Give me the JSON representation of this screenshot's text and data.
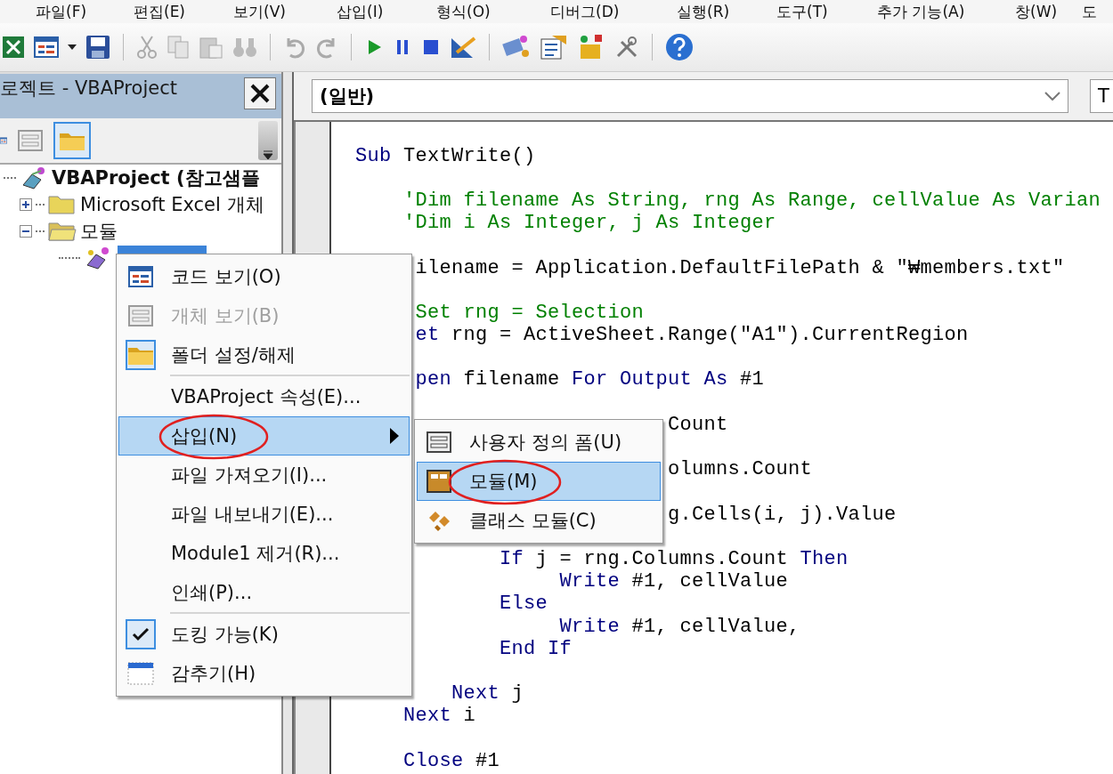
{
  "menu_bar": [
    "파일(F)",
    "편집(E)",
    "보기(V)",
    "삽입(I)",
    "형식(O)",
    "디버그(D)",
    "실행(R)",
    "도구(T)",
    "추가 기능(A)",
    "창(W)",
    "도"
  ],
  "project_panel": {
    "title": "로젝트 - VBAProject",
    "folders_on": true,
    "tree": [
      {
        "label": "VBAProject (참고샘플",
        "selected": false,
        "children": [
          {
            "label": "Microsoft Excel 개체",
            "expanded": false,
            "selected": false
          },
          {
            "label": "모듈",
            "expanded": true,
            "selected": false,
            "children": [
              {
                "selected": true
              }
            ]
          }
        ]
      }
    ]
  },
  "code_window": {
    "object_box": "(일반)",
    "procedure_box": "T",
    "lines": [
      {
        "kind": "code",
        "segments": [
          {
            "kind": "keyword",
            "text": "Sub"
          },
          {
            "kind": "plain",
            "text": " TextWrite()"
          }
        ]
      },
      {
        "kind": "blank"
      },
      {
        "kind": "code",
        "segments": [
          {
            "kind": "comment",
            "text": "    'Dim filename As String, rng As Range, cellValue As Varian"
          }
        ]
      },
      {
        "kind": "code",
        "segments": [
          {
            "kind": "comment",
            "text": "    'Dim i As Integer, j As Integer"
          }
        ]
      },
      {
        "kind": "blank"
      },
      {
        "kind": "code",
        "segments": [
          {
            "kind": "plain",
            "text": "     ilename = Application.DefaultFilePath & \"₩members.txt\""
          }
        ]
      },
      {
        "kind": "blank"
      },
      {
        "kind": "code",
        "segments": [
          {
            "kind": "comment",
            "text": "     Set rng = Selection"
          }
        ]
      },
      {
        "kind": "code",
        "segments": [
          {
            "kind": "keyword",
            "text": "     et"
          },
          {
            "kind": "plain",
            "text": " rng = ActiveSheet.Range(\"A1\").CurrentRegion"
          }
        ]
      },
      {
        "kind": "blank"
      },
      {
        "kind": "code",
        "segments": [
          {
            "kind": "keyword",
            "text": "     pen"
          },
          {
            "kind": "plain",
            "text": " filename "
          },
          {
            "kind": "keyword",
            "text": "For Output As"
          },
          {
            "kind": "plain",
            "text": " #1"
          }
        ]
      },
      {
        "kind": "blank"
      },
      {
        "kind": "code",
        "segments": [
          {
            "kind": "plain",
            "text": "                          Count"
          }
        ]
      },
      {
        "kind": "blank"
      },
      {
        "kind": "code",
        "segments": [
          {
            "kind": "plain",
            "text": "                          olumns.Count"
          }
        ]
      },
      {
        "kind": "blank"
      },
      {
        "kind": "code",
        "segments": [
          {
            "kind": "plain",
            "text": "                          g.Cells(i, j).Value"
          }
        ]
      },
      {
        "kind": "blank"
      },
      {
        "kind": "code",
        "segments": [
          {
            "kind": "keyword",
            "text": "            If"
          },
          {
            "kind": "plain",
            "text": " j = rng.Columns.Count "
          },
          {
            "kind": "keyword",
            "text": "Then"
          }
        ]
      },
      {
        "kind": "code",
        "segments": [
          {
            "kind": "keyword",
            "text": "                 Write"
          },
          {
            "kind": "plain",
            "text": " #1, cellValue"
          }
        ]
      },
      {
        "kind": "code",
        "segments": [
          {
            "kind": "keyword",
            "text": "            Else"
          }
        ]
      },
      {
        "kind": "code",
        "segments": [
          {
            "kind": "keyword",
            "text": "                 Write"
          },
          {
            "kind": "plain",
            "text": " #1, cellValue,"
          }
        ]
      },
      {
        "kind": "code",
        "segments": [
          {
            "kind": "keyword",
            "text": "            End If"
          }
        ]
      },
      {
        "kind": "blank"
      },
      {
        "kind": "code",
        "segments": [
          {
            "kind": "keyword",
            "text": "        Next"
          },
          {
            "kind": "plain",
            "text": " j"
          }
        ]
      },
      {
        "kind": "code",
        "segments": [
          {
            "kind": "keyword",
            "text": "    Next"
          },
          {
            "kind": "plain",
            "text": " i"
          }
        ]
      },
      {
        "kind": "blank"
      },
      {
        "kind": "code",
        "segments": [
          {
            "kind": "keyword",
            "text": "    Close"
          },
          {
            "kind": "plain",
            "text": " #1"
          }
        ]
      }
    ]
  },
  "context_menu": {
    "items": [
      {
        "kind": "item",
        "label": "코드 보기(O)",
        "disabled": false,
        "checked": false,
        "selected": false
      },
      {
        "kind": "item",
        "label": "개체 보기(B)",
        "disabled": true,
        "checked": false,
        "selected": false
      },
      {
        "kind": "item",
        "label": "폴더 설정/해제",
        "disabled": false,
        "checked": true,
        "selected": false
      },
      {
        "kind": "separator"
      },
      {
        "kind": "item",
        "label": "VBAProject 속성(E)...",
        "disabled": false,
        "checked": false,
        "selected": false
      },
      {
        "kind": "item",
        "label": "삽입(N)",
        "disabled": false,
        "checked": false,
        "selected": true,
        "submenu": true,
        "annotated": true
      },
      {
        "kind": "item",
        "label": "파일 가져오기(I)...",
        "disabled": false,
        "checked": false,
        "selected": false
      },
      {
        "kind": "item",
        "label": "파일 내보내기(E)...",
        "disabled": false,
        "checked": false,
        "selected": false
      },
      {
        "kind": "item",
        "label": "Module1 제거(R)...",
        "disabled": false,
        "checked": false,
        "selected": false
      },
      {
        "kind": "item",
        "label": "인쇄(P)...",
        "disabled": false,
        "checked": false,
        "selected": false
      },
      {
        "kind": "separator"
      },
      {
        "kind": "item",
        "label": "도킹 가능(K)",
        "disabled": false,
        "checked": true,
        "selected": false
      },
      {
        "kind": "item",
        "label": "감추기(H)",
        "disabled": false,
        "checked": false,
        "selected": false
      }
    ]
  },
  "submenu": {
    "items": [
      {
        "label": "사용자 정의 폼(U)",
        "selected": false
      },
      {
        "label": "모듈(M)",
        "selected": true,
        "annotated": true
      },
      {
        "label": "클래스 모듈(C)",
        "selected": false
      }
    ]
  }
}
